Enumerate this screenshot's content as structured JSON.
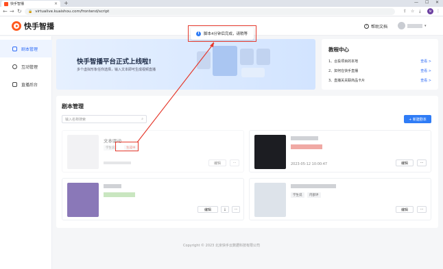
{
  "browser": {
    "tab_title": "快手智播",
    "url": "virtualive.kuaishou.com/frontend/script",
    "profile_initial": "M"
  },
  "header": {
    "brand": "快手智播",
    "help_doc": "帮助文档"
  },
  "toast": {
    "message": "脚本4分钟后完成，请稍等"
  },
  "sidebar": {
    "items": [
      {
        "label": "剧本管理",
        "active": true
      },
      {
        "label": "互动管理",
        "active": false
      },
      {
        "label": "直播后台",
        "active": false
      }
    ]
  },
  "banner": {
    "headline": "快手智播平台正式上线啦!",
    "subtext": "多个虚拟形象任你选择，输入文本即可生成视频直播"
  },
  "tutorial": {
    "title": "教程中心",
    "items": [
      {
        "label": "1、合投项目的本地",
        "link": "查看 >"
      },
      {
        "label": "2、如何在快手直播",
        "link": "查看 >"
      },
      {
        "label": "3、直播关关联商品卡片",
        "link": "查看 >"
      }
    ]
  },
  "scripts": {
    "title": "剧本管理",
    "search_placeholder": "输入名称搜索",
    "new_button": "+ 新建剧本",
    "cards": [
      {
        "title": "文本驱动",
        "tags": [
          "学生说",
          "生成中"
        ],
        "actions": [
          "编辑",
          "···"
        ],
        "timestamp": ""
      },
      {
        "title": "",
        "tags": [],
        "actions": [
          "编辑",
          "···"
        ],
        "timestamp": "2023-05-12 10:00:47"
      },
      {
        "title": "",
        "tags": [],
        "actions": [
          "编辑",
          "⤓",
          "···"
        ],
        "timestamp": ""
      },
      {
        "title": "",
        "tags": [
          "学生说",
          "内部评"
        ],
        "actions": [
          "编辑",
          "···"
        ],
        "timestamp": ""
      }
    ]
  },
  "footer": {
    "copyright": "Copyright © 2023 北京快手云数据科技有限公司"
  },
  "colors": {
    "accent": "#2f7cf6",
    "brand": "#ff5a1f",
    "annotation": "#e5382b"
  }
}
